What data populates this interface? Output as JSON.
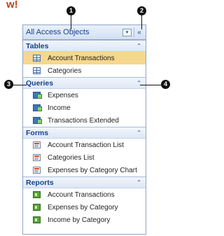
{
  "heading_fragment": "w!",
  "pane": {
    "title": "All Access Objects",
    "dropdown_glyph": "▾",
    "shutter_glyph": "«",
    "groups": [
      {
        "label": "Tables",
        "icon": "table-icon",
        "items": [
          {
            "label": "Account Transactions",
            "selected": true
          },
          {
            "label": "Categories"
          }
        ]
      },
      {
        "label": "Queries",
        "icon": "query-icon",
        "items": [
          {
            "label": "Expenses"
          },
          {
            "label": "Income"
          },
          {
            "label": "Transactions Extended"
          }
        ]
      },
      {
        "label": "Forms",
        "icon": "form-icon",
        "items": [
          {
            "label": "Account Transaction List"
          },
          {
            "label": "Categories List"
          },
          {
            "label": "Expenses by Category Chart"
          }
        ]
      },
      {
        "label": "Reports",
        "icon": "report-icon",
        "items": [
          {
            "label": "Account Transactions"
          },
          {
            "label": "Expenses by Category"
          },
          {
            "label": "Income by Category"
          }
        ]
      }
    ],
    "collapse_glyph": "⌃"
  },
  "callouts": [
    "1",
    "2",
    "3",
    "4"
  ],
  "colors": {
    "selection": "#f6d78e",
    "header_text": "#15428b",
    "border": "#8da6c9"
  }
}
